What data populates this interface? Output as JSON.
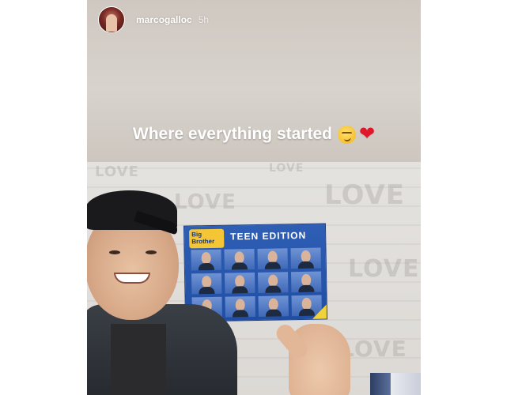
{
  "story": {
    "username": "marcogalloc",
    "timestamp": "5h",
    "caption": "Where everything started",
    "caption_emojis": [
      "smirking-face-emoji",
      "red-heart-emoji"
    ]
  },
  "photo": {
    "wall_words": [
      "LOVE",
      "LOVE",
      "LOVE",
      "LOVE",
      "LOVE",
      "LOVE"
    ],
    "poster": {
      "logo": "Big Brother",
      "title": "TEEN EDITION",
      "faces_count": 12
    }
  },
  "colors": {
    "text": "#ffffff",
    "heart": "#e0162b",
    "poster_blue": "#2f5fb5",
    "poster_accent": "#f2d23a"
  }
}
